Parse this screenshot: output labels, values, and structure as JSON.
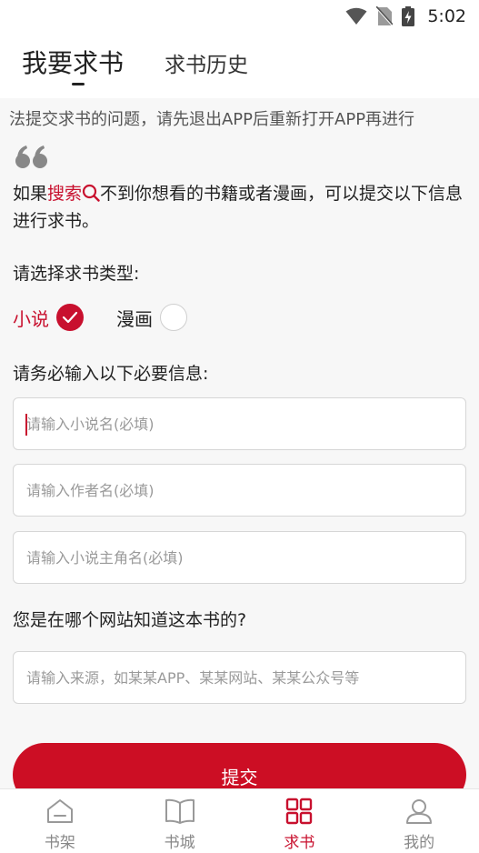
{
  "status_bar": {
    "time": "5:02"
  },
  "header": {
    "tab_active": "我要求书",
    "tab_history": "求书历史"
  },
  "notice": "法提交求书的问题，请先退出APP后重新打开APP再进行",
  "intro": {
    "prefix": "如果",
    "highlight": "搜索",
    "rest": "不到你想看的书籍或者漫画，可以提交以下信息进行求书。"
  },
  "type_label": "请选择求书类型:",
  "type_options": [
    {
      "label": "小说",
      "selected": true
    },
    {
      "label": "漫画",
      "selected": false
    }
  ],
  "required_label": "请务必输入以下必要信息:",
  "fields": {
    "book_name": "请输入小说名(必填)",
    "author": "请输入作者名(必填)",
    "protagonist": "请输入小说主角名(必填)",
    "source": "请输入来源，如某某APP、某某网站、某某公众号等"
  },
  "source_label": "您是在哪个网站知道这本书的?",
  "submit_label": "提交",
  "bottom_nav": [
    {
      "label": "书架",
      "icon": "home-icon",
      "active": false
    },
    {
      "label": "书城",
      "icon": "book-icon",
      "active": false
    },
    {
      "label": "求书",
      "icon": "grid-icon",
      "active": true
    },
    {
      "label": "我的",
      "icon": "user-icon",
      "active": false
    }
  ],
  "colors": {
    "accent": "#c8102e",
    "background": "#f7f7f7"
  }
}
